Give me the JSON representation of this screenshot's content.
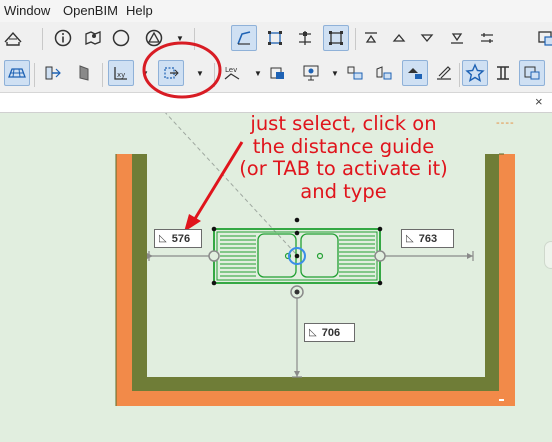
{
  "menu": {
    "items": [
      "Window",
      "OpenBIM",
      "Help"
    ]
  },
  "toolbar1": {
    "icons": [
      "roof-icon",
      "info-icon",
      "map-pin-icon",
      "compass-icon",
      "triangle-icon",
      "dropdown-arrow",
      "trace-reference-icon",
      "fit-selection-icon",
      "snap-grid-icon",
      "bounding-box-icon",
      "align-top-icon",
      "arrow-up-icon",
      "arrow-down-icon",
      "align-bottom-icon",
      "window-icon"
    ]
  },
  "toolbar2": {
    "icons": [
      "slab-icon",
      "wall-icon",
      "door-icon",
      "move-xy-icon",
      "distance-guide-icon",
      "dropdown-arrow",
      "level-dims-icon",
      "element-info-icon",
      "display-icon",
      "tag-icon",
      "label-icon",
      "detail-icon",
      "edit-icon",
      "star-icon",
      "column-icon",
      "layer-icon"
    ]
  },
  "tab": {
    "close_label": "×"
  },
  "canvas": {
    "annotation": "just select, click on the distance guide (or TAB to activate it)  and type",
    "dimensions": {
      "left": "576",
      "right": "763",
      "bottom": "706"
    },
    "dim_icon": "◺",
    "dash_marker": "----",
    "colors": {
      "background": "#e1eedf",
      "wall_outer": "#f28a49",
      "wall_inner": "#6f7d37",
      "sink": "#22a033",
      "annotation": "#e0141c",
      "guide": "#8a8a8a",
      "highlight_circle": "#d81c24"
    }
  }
}
